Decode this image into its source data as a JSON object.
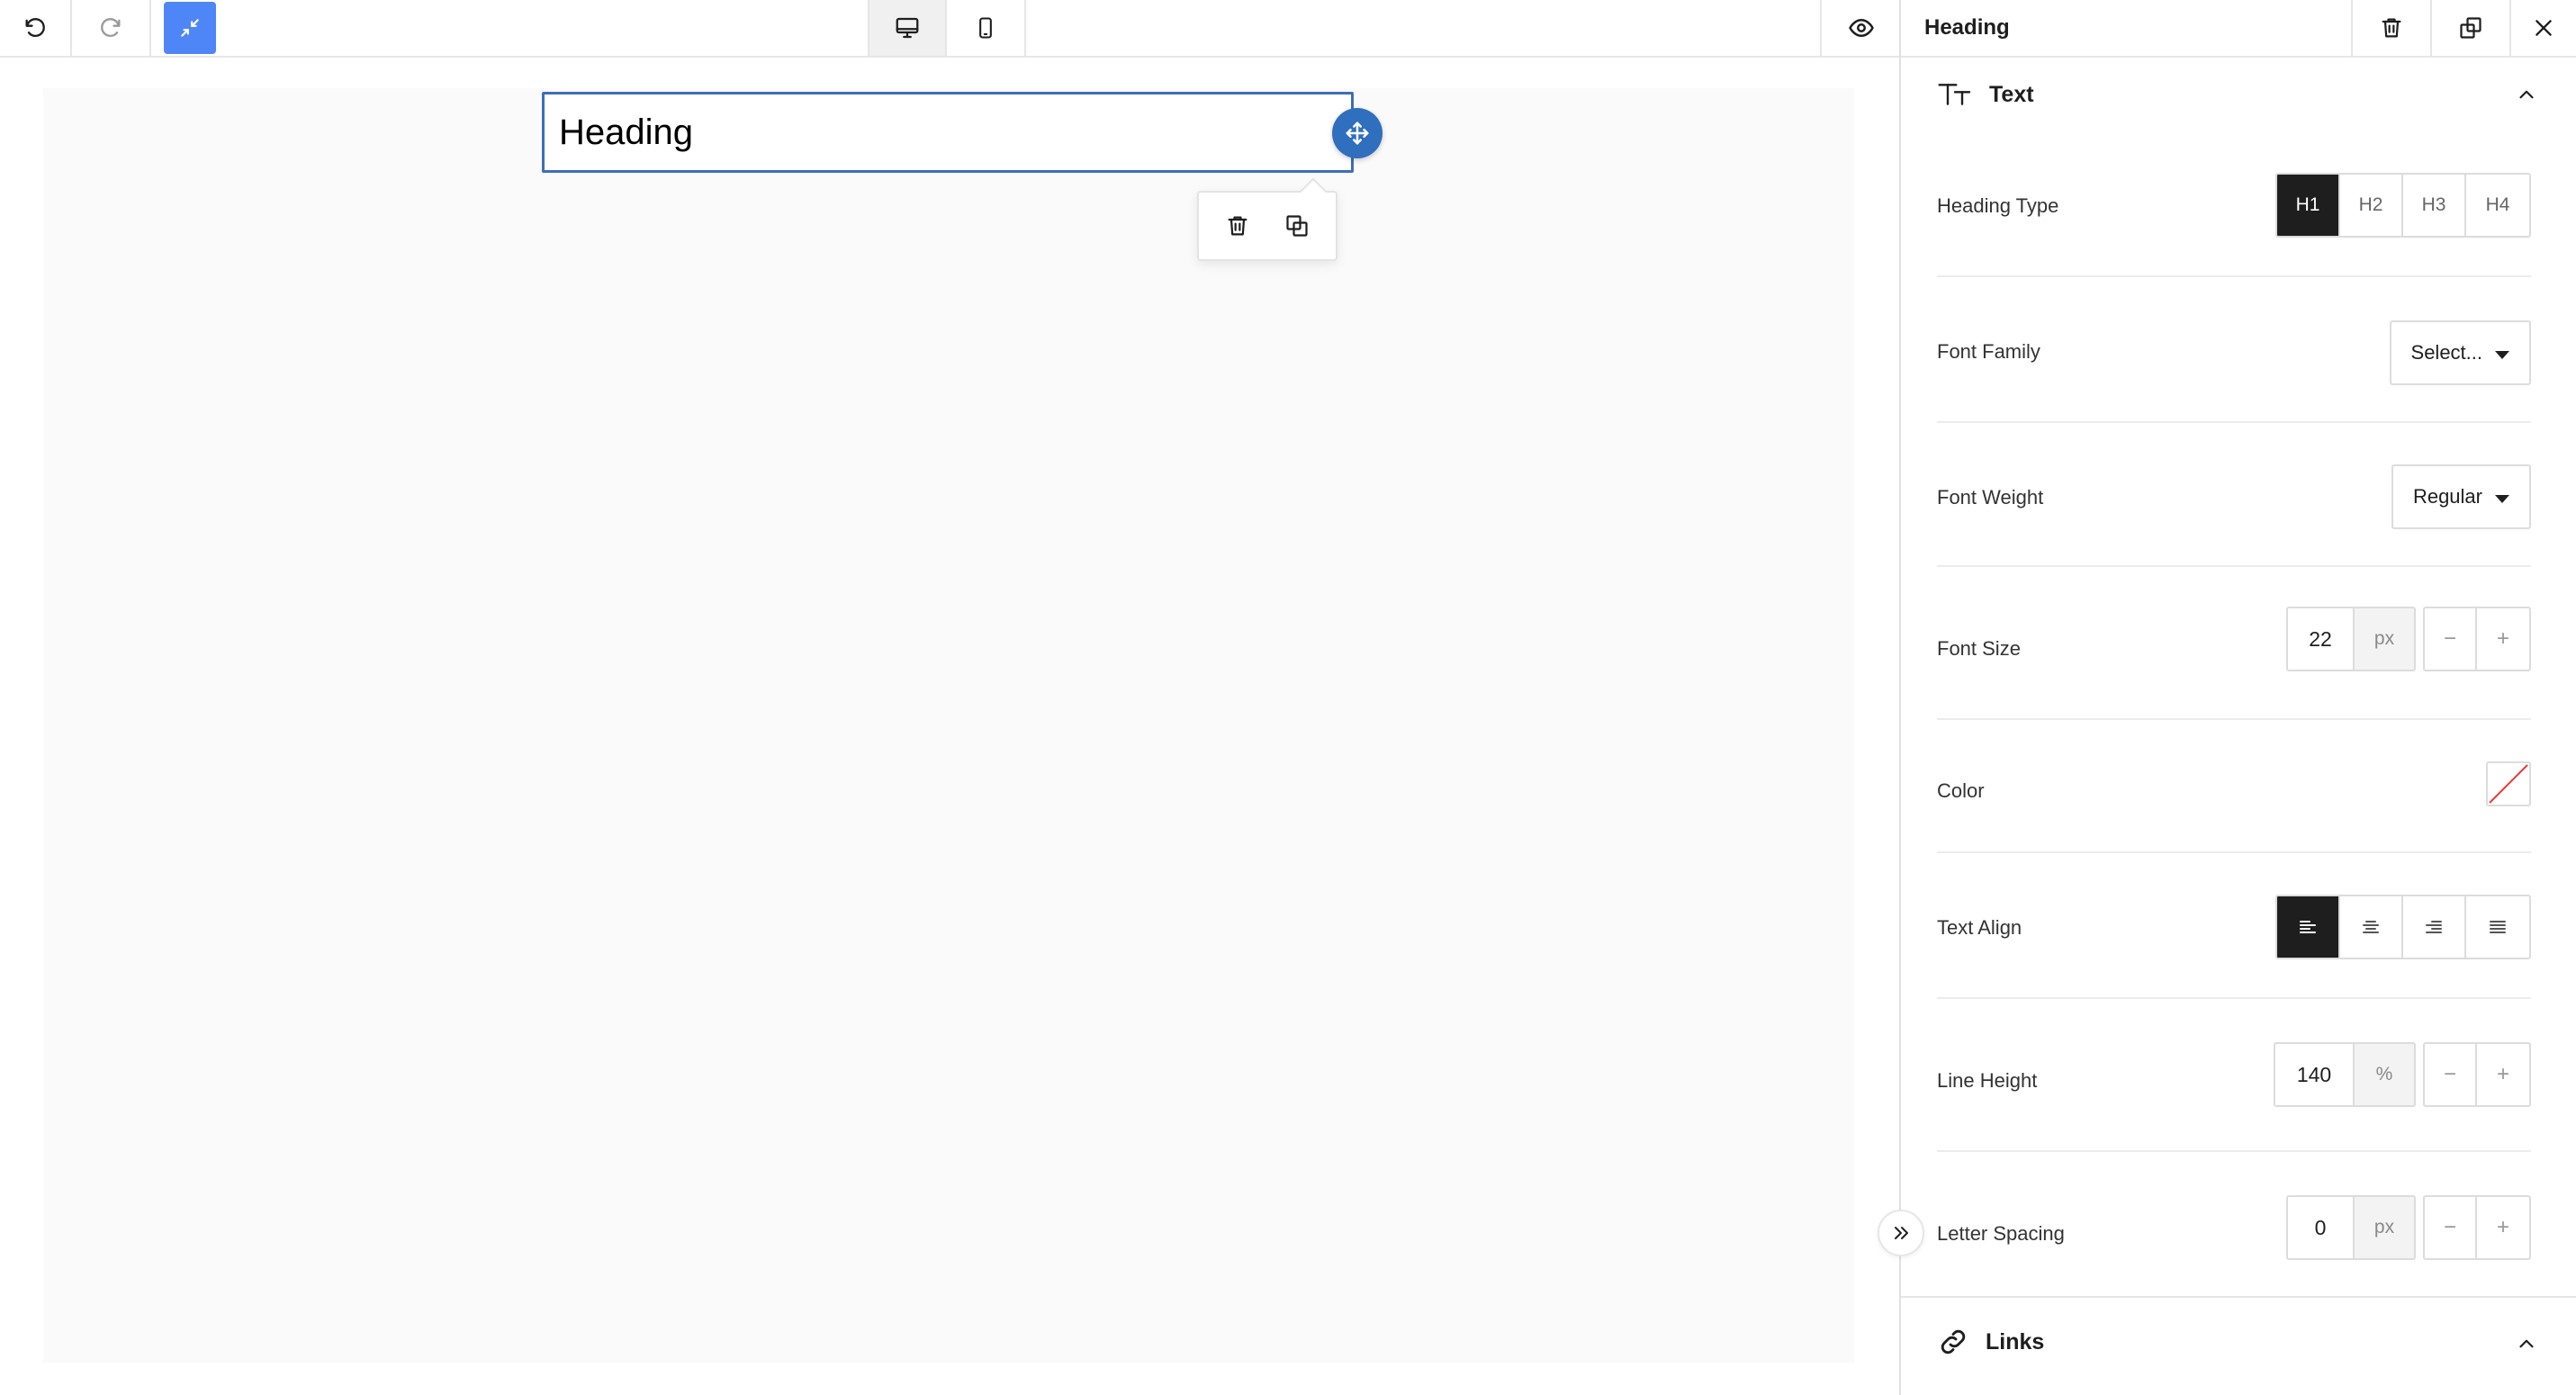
{
  "canvas": {
    "heading_text": "Heading"
  },
  "panel": {
    "title": "Heading",
    "text_section": {
      "label": "Text",
      "heading_type": {
        "label": "Heading Type",
        "options": [
          "H1",
          "H2",
          "H3",
          "H4"
        ],
        "selected": "H1"
      },
      "font_family": {
        "label": "Font Family",
        "value": "Select..."
      },
      "font_weight": {
        "label": "Font Weight",
        "value": "Regular"
      },
      "font_size": {
        "label": "Font Size",
        "value": "22",
        "unit": "px"
      },
      "color": {
        "label": "Color"
      },
      "text_align": {
        "label": "Text Align",
        "selected": "left"
      },
      "line_height": {
        "label": "Line Height",
        "value": "140",
        "unit": "%"
      },
      "letter_spacing": {
        "label": "Letter Spacing",
        "value": "0",
        "unit": "px"
      },
      "stepper": {
        "minus": "−",
        "plus": "+"
      }
    },
    "links_section": {
      "label": "Links"
    }
  },
  "colors": {
    "accent": "#4f86f7",
    "selection_border": "#3d6fb6",
    "drag_handle": "#2f6fbd",
    "active_segment": "#1e1e1e",
    "no_color_slash": "#e53935"
  },
  "icons": {
    "toolbar": [
      "undo-icon",
      "redo-icon",
      "collapse-icon",
      "desktop-icon",
      "mobile-icon",
      "eye-icon"
    ],
    "panel_header": [
      "trash-icon",
      "duplicate-icon",
      "close-icon"
    ],
    "block_popover": [
      "trash-icon",
      "duplicate-icon"
    ]
  }
}
